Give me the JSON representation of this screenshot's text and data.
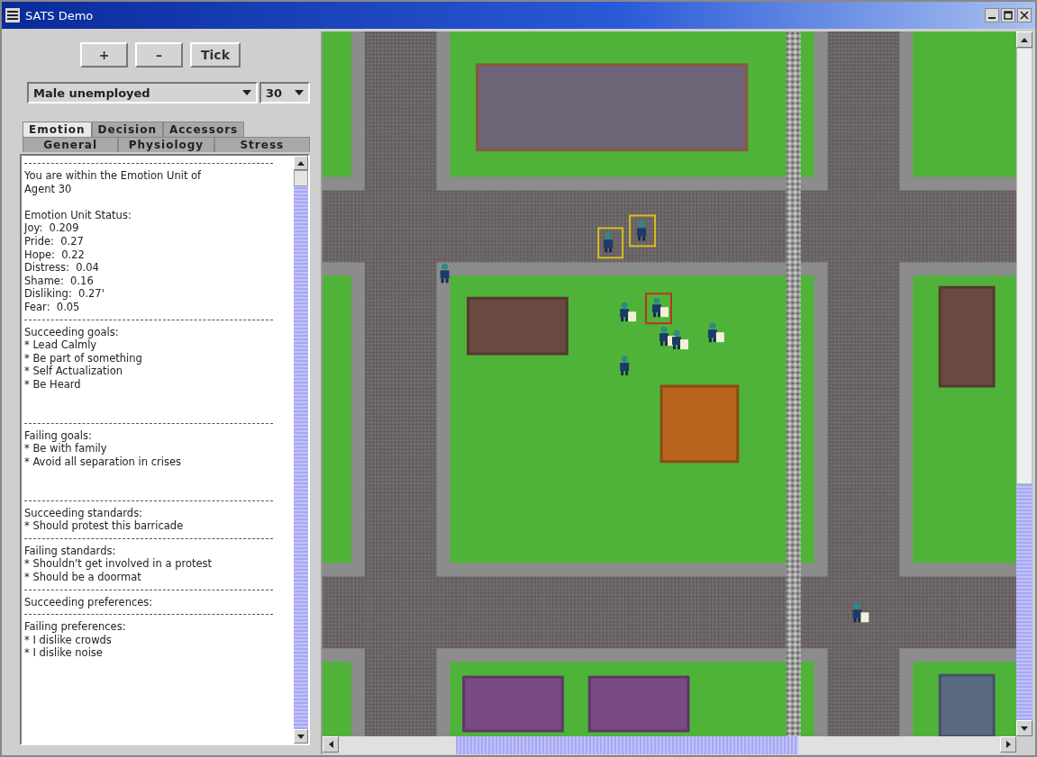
{
  "window": {
    "title": "SATS Demo"
  },
  "toolbar": {
    "buttons": [
      "+",
      "–",
      "Tick"
    ]
  },
  "agent_select": {
    "value": "Male unemployed"
  },
  "agent_number": {
    "value": "30"
  },
  "tab_rows": [
    {
      "tabs": [
        {
          "label": "Emotion",
          "selected": true
        },
        {
          "label": "Decision",
          "selected": false
        },
        {
          "label": "Accessors",
          "selected": false
        }
      ]
    },
    {
      "tabs": [
        {
          "label": "General",
          "selected": false
        },
        {
          "label": "Physiology",
          "selected": false
        },
        {
          "label": "Stress",
          "selected": false
        }
      ]
    }
  ],
  "log": {
    "lines": [
      {
        "kind": "rule"
      },
      {
        "kind": "text",
        "text": "You are within the Emotion Unit of"
      },
      {
        "kind": "text",
        "text": "Agent 30"
      },
      {
        "kind": "gap"
      },
      {
        "kind": "text",
        "text": "Emotion Unit Status:"
      },
      {
        "kind": "text",
        "text": "Joy:  0.209"
      },
      {
        "kind": "text",
        "text": "Pride:  0.27"
      },
      {
        "kind": "text",
        "text": "Hope:  0.22"
      },
      {
        "kind": "text",
        "text": "Distress:  0.04"
      },
      {
        "kind": "text",
        "text": "Shame:  0.16"
      },
      {
        "kind": "text",
        "text": "Disliking:  0.27'"
      },
      {
        "kind": "text",
        "text": "Fear:  0.05"
      },
      {
        "kind": "rule"
      },
      {
        "kind": "text",
        "text": "Succeeding goals:"
      },
      {
        "kind": "text",
        "text": "* Lead Calmly"
      },
      {
        "kind": "text",
        "text": "* Be part of something"
      },
      {
        "kind": "text",
        "text": "* Self Actualization"
      },
      {
        "kind": "text",
        "text": "* Be Heard"
      },
      {
        "kind": "gap"
      },
      {
        "kind": "gap"
      },
      {
        "kind": "rule"
      },
      {
        "kind": "text",
        "text": "Failing goals:"
      },
      {
        "kind": "text",
        "text": "* Be with family"
      },
      {
        "kind": "text",
        "text": "* Avoid all separation in crises"
      },
      {
        "kind": "gap"
      },
      {
        "kind": "gap"
      },
      {
        "kind": "rule"
      },
      {
        "kind": "text",
        "text": "Succeeding standards:"
      },
      {
        "kind": "text",
        "text": "* Should protest this barricade"
      },
      {
        "kind": "rule"
      },
      {
        "kind": "text",
        "text": "Failing standards:"
      },
      {
        "kind": "text",
        "text": "* Shouldn't get involved in a protest"
      },
      {
        "kind": "text",
        "text": "* Should be a doormat"
      },
      {
        "kind": "rule"
      },
      {
        "kind": "text",
        "text": "Succeeding preferences:"
      },
      {
        "kind": "rule"
      },
      {
        "kind": "text",
        "text": "Failing preferences:"
      },
      {
        "kind": "text",
        "text": "* I dislike crowds"
      },
      {
        "kind": "text",
        "text": "* I dislike noise"
      }
    ]
  }
}
